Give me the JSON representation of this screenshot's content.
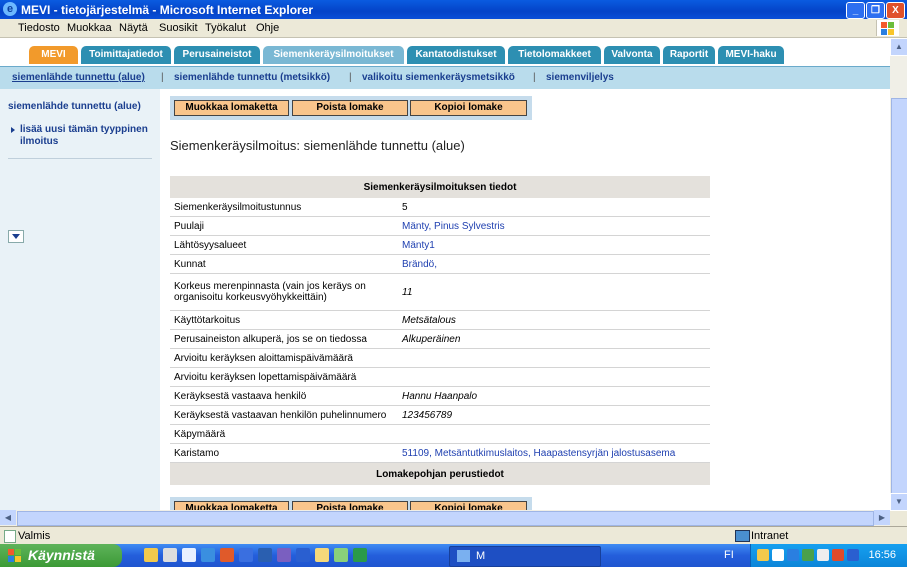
{
  "window": {
    "title": "MEVI - tietojärjestelmä - Microsoft Internet Explorer",
    "min": "_",
    "max": "❐",
    "close": "X"
  },
  "menu": [
    "Tiedosto",
    "Muokkaa",
    "Näytä",
    "Suosikit",
    "Työkalut",
    "Ohje"
  ],
  "tabs": [
    "MEVI",
    "Toimittajatiedot",
    "Perusaineistot",
    "Siemenkeräysilmoitukset",
    "Kantatodistukset",
    "Tietolomakkeet",
    "Valvonta",
    "Raportit",
    "MEVI-haku"
  ],
  "subnav": [
    "siemenlähde tunnettu (alue)",
    "siemenlähde tunnettu (metsikkö)",
    "valikoitu siemenkeräysmetsikkö",
    "siemenviljelys"
  ],
  "subnav_sep": "|",
  "sidebar": {
    "heading": "siemenlähde tunnettu (alue)",
    "link": "lisää uusi tämän tyyppinen ilmoitus"
  },
  "buttons": {
    "edit": "Muokkaa lomaketta",
    "delete": "Poista lomake",
    "copy": "Kopioi lomake"
  },
  "page_title": "Siemenkeräysilmoitus: siemenlähde tunnettu (alue)",
  "table": {
    "header": "Siemenkeräysilmoituksen tiedot",
    "footer": "Lomakepohjan perustiedot",
    "rows": [
      {
        "label": "Siemenkeräysilmoitustunnus",
        "value": "5"
      },
      {
        "label": "Puulaji",
        "value": "Mänty, Pinus Sylvestris"
      },
      {
        "label": "Lähtösyysalueet",
        "value": "Mänty1"
      },
      {
        "label": "Kunnat",
        "value": "Brändö,"
      },
      {
        "label": "Korkeus merenpinnasta (vain jos keräys on organisoitu korkeusvyöhykkeittäin)",
        "value": "11"
      },
      {
        "label": "Käyttötarkoitus",
        "value": "Metsätalous"
      },
      {
        "label": "Perusaineiston alkuperä, jos se on tiedossa",
        "value": "Alkuperäinen"
      },
      {
        "label": "Arvioitu keräyksen aloittamispäivämäärä",
        "value": ""
      },
      {
        "label": "Arvioitu keräyksen lopettamispäivämäärä",
        "value": ""
      },
      {
        "label": "Keräyksestä vastaava henkilö",
        "value": "Hannu Haanpalo"
      },
      {
        "label": "Keräyksestä vastaavan henkilön puhelinnumero",
        "value": "123456789"
      },
      {
        "label": "Käpymäärä",
        "value": ""
      },
      {
        "label": "Karistamo",
        "value": "51109, Metsäntutkimuslaitos, Haapastensyrjän jalostusasema"
      }
    ]
  },
  "status": {
    "left": "Valmis",
    "zone": "Intranet"
  },
  "taskbar": {
    "start": "Käynnistä",
    "task": "M",
    "lang": "FI",
    "clock": "16:56"
  },
  "colors": {
    "tab_blue": "#2d8fb2",
    "tab_orange": "#f29a2b",
    "button_fill": "#f9c58c",
    "link": "#1e3fb0"
  }
}
